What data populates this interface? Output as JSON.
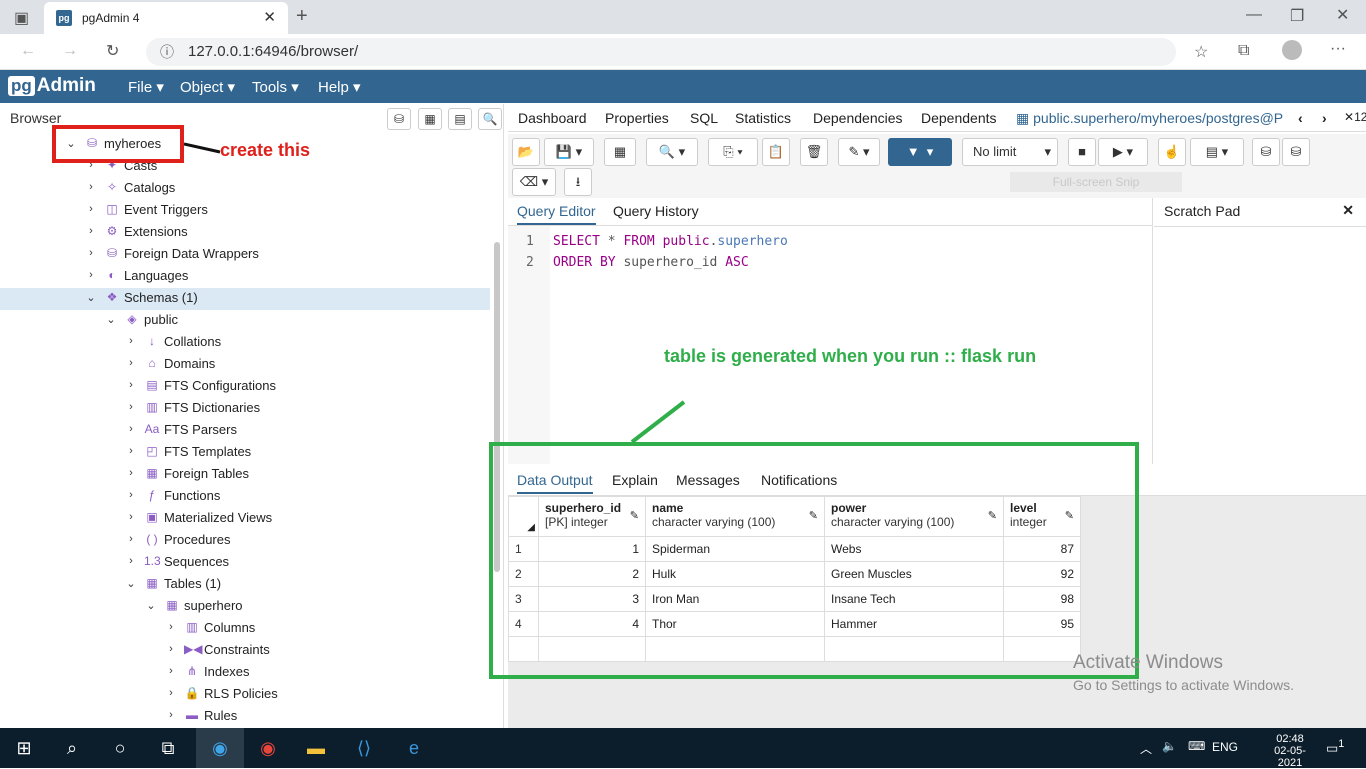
{
  "browser": {
    "tab_title": "pgAdmin 4",
    "url": "127.0.0.1:64946/browser/"
  },
  "app": {
    "logo_pg": "pg",
    "logo_text": "Admin",
    "menus": [
      "File",
      "Object",
      "Tools",
      "Help"
    ]
  },
  "left_panel": {
    "title": "Browser",
    "tree": [
      {
        "label": "myheroes",
        "icon": "database-icon",
        "expanded": true
      },
      {
        "label": "Casts",
        "icon": "casts-icon"
      },
      {
        "label": "Catalogs",
        "icon": "catalogs-icon"
      },
      {
        "label": "Event Triggers",
        "icon": "event-triggers-icon"
      },
      {
        "label": "Extensions",
        "icon": "extensions-icon"
      },
      {
        "label": "Foreign Data Wrappers",
        "icon": "fdw-icon"
      },
      {
        "label": "Languages",
        "icon": "languages-icon"
      },
      {
        "label": "Schemas (1)",
        "icon": "schemas-icon",
        "expanded": true,
        "selected": true
      },
      {
        "label": "public",
        "icon": "schema-icon",
        "expanded": true
      },
      {
        "label": "Collations",
        "icon": "collations-icon"
      },
      {
        "label": "Domains",
        "icon": "domains-icon"
      },
      {
        "label": "FTS Configurations",
        "icon": "fts-config-icon"
      },
      {
        "label": "FTS Dictionaries",
        "icon": "fts-dict-icon"
      },
      {
        "label": "FTS Parsers",
        "icon": "fts-parsers-icon"
      },
      {
        "label": "FTS Templates",
        "icon": "fts-templates-icon"
      },
      {
        "label": "Foreign Tables",
        "icon": "foreign-tables-icon"
      },
      {
        "label": "Functions",
        "icon": "functions-icon"
      },
      {
        "label": "Materialized Views",
        "icon": "mat-views-icon"
      },
      {
        "label": "Procedures",
        "icon": "procedures-icon"
      },
      {
        "label": "Sequences",
        "icon": "sequences-icon"
      },
      {
        "label": "Tables (1)",
        "icon": "tables-icon",
        "expanded": true
      },
      {
        "label": "superhero",
        "icon": "table-icon",
        "expanded": true
      },
      {
        "label": "Columns",
        "icon": "columns-icon"
      },
      {
        "label": "Constraints",
        "icon": "constraints-icon"
      },
      {
        "label": "Indexes",
        "icon": "indexes-icon"
      },
      {
        "label": "RLS Policies",
        "icon": "rls-icon"
      },
      {
        "label": "Rules",
        "icon": "rules-icon"
      }
    ]
  },
  "annotations": {
    "red_note": "create this",
    "green_note": "table is generated when you run ::  flask run"
  },
  "main_tabs": [
    "Dashboard",
    "Properties",
    "SQL",
    "Statistics",
    "Dependencies",
    "Dependents",
    "public.superhero/myheroes/postgres@P"
  ],
  "main_tab_overflow": "12",
  "toolbar": {
    "limit_select": "No limit",
    "hint": "Full-screen Snip"
  },
  "editor": {
    "tabs": [
      "Query Editor",
      "Query History"
    ],
    "scratch_title": "Scratch Pad",
    "lines": [
      {
        "n": "1",
        "parts": [
          {
            "t": "SELECT",
            "c": "kw"
          },
          {
            "t": " * ",
            "c": "id"
          },
          {
            "t": "FROM",
            "c": "kw"
          },
          {
            "t": " ",
            "c": "id"
          },
          {
            "t": "public",
            "c": "kw"
          },
          {
            "t": ".",
            "c": "id"
          },
          {
            "t": "superhero",
            "c": "tn"
          }
        ]
      },
      {
        "n": "2",
        "parts": [
          {
            "t": "ORDER BY",
            "c": "kw"
          },
          {
            "t": " superhero_id ",
            "c": "id"
          },
          {
            "t": "ASC",
            "c": "kw"
          }
        ]
      }
    ]
  },
  "output": {
    "tabs": [
      "Data Output",
      "Explain",
      "Messages",
      "Notifications"
    ],
    "columns": [
      {
        "name": "superhero_id",
        "type": "[PK] integer"
      },
      {
        "name": "name",
        "type": "character varying (100)"
      },
      {
        "name": "power",
        "type": "character varying (100)"
      },
      {
        "name": "level",
        "type": "integer"
      }
    ],
    "rows": [
      [
        "1",
        "1",
        "Spiderman",
        "Webs",
        "87"
      ],
      [
        "2",
        "2",
        "Hulk",
        "Green Muscles",
        "92"
      ],
      [
        "3",
        "3",
        "Iron Man",
        "Insane Tech",
        "98"
      ],
      [
        "4",
        "4",
        "Thor",
        "Hammer",
        "95"
      ]
    ]
  },
  "watermark": {
    "line1": "Activate Windows",
    "line2": "Go to Settings to activate Windows."
  },
  "taskbar": {
    "lang": "ENG",
    "time": "02:48",
    "date": "02-05-2021",
    "notif_count": "1"
  },
  "colors": {
    "brand": "#326690",
    "red_annotation": "#e0201b",
    "green_annotation": "#2fae4a"
  }
}
